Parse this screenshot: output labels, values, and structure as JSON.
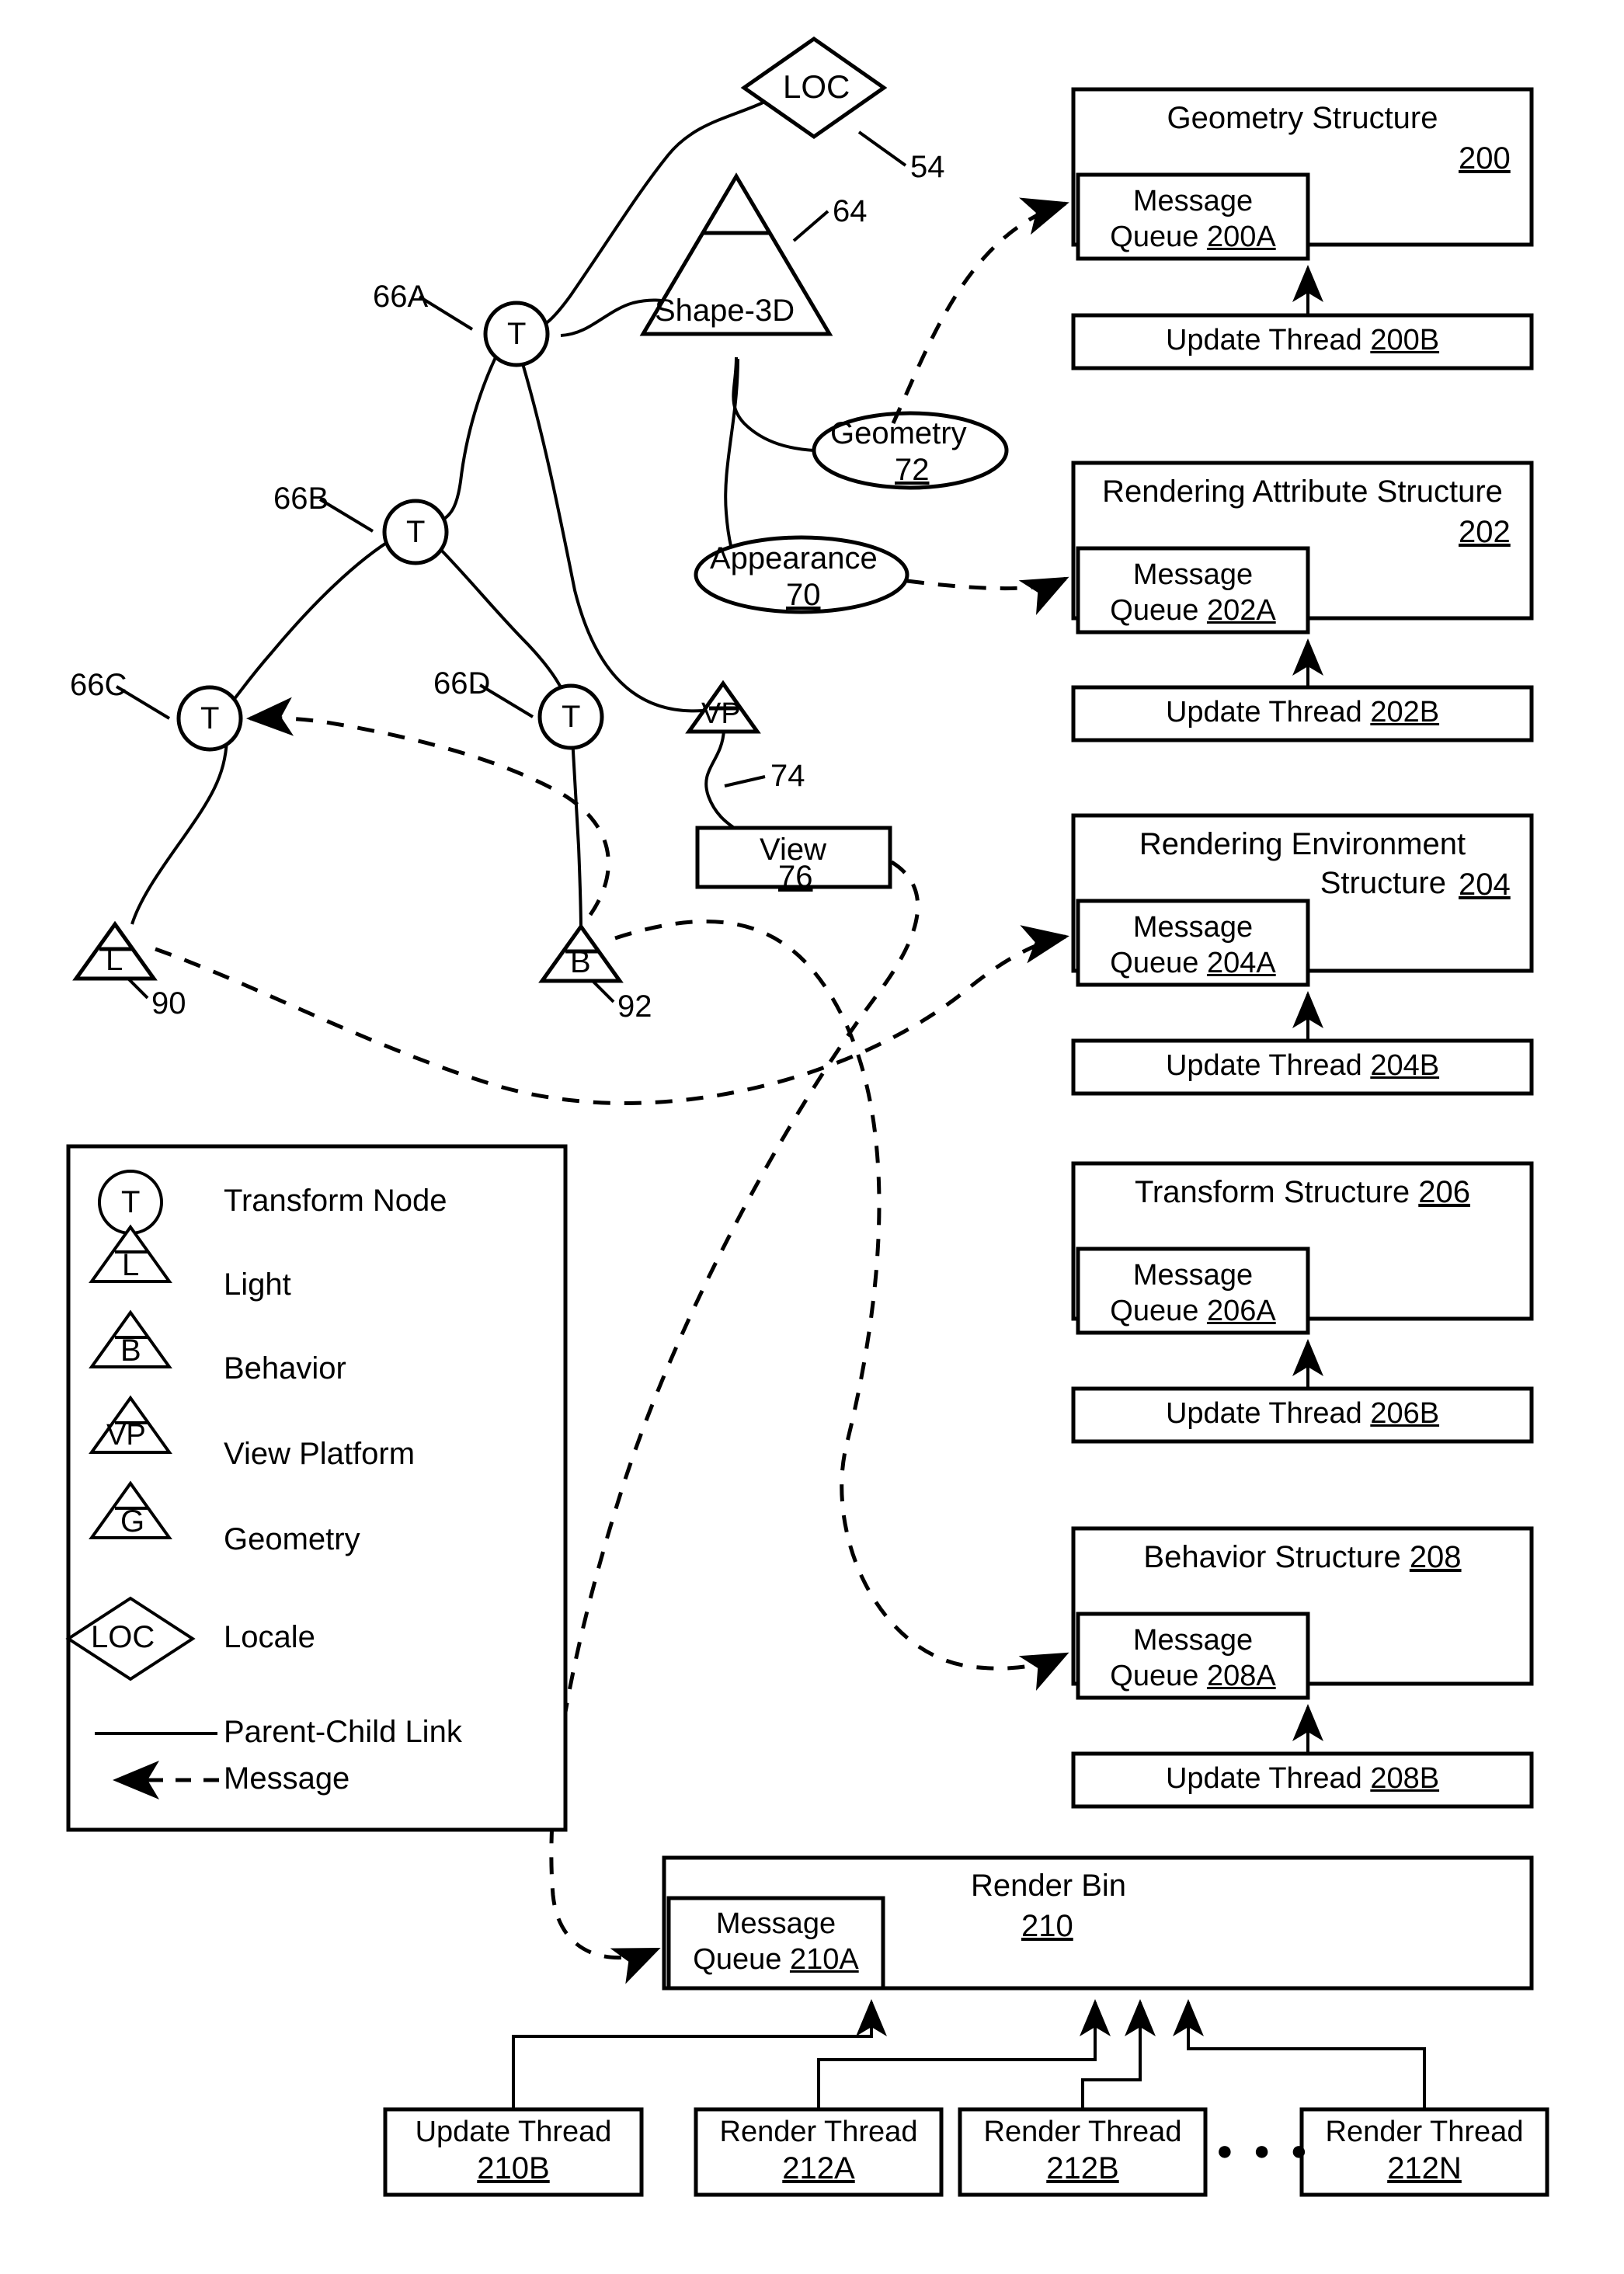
{
  "figure": {
    "type": "patent-diagram",
    "title": "Scene graph and retained mode structures with message queues and threads"
  },
  "scene_graph": {
    "locale": {
      "label": "LOC",
      "ref": "54"
    },
    "shape3d": {
      "label": "Shape-3D",
      "ref": "64"
    },
    "transforms": [
      {
        "label": "T",
        "ref": "66A"
      },
      {
        "label": "T",
        "ref": "66B"
      },
      {
        "label": "T",
        "ref": "66C"
      },
      {
        "label": "T",
        "ref": "66D"
      }
    ],
    "geometry_node": {
      "label": "Geometry",
      "ref": "72"
    },
    "appearance_node": {
      "label": "Appearance",
      "ref": "70"
    },
    "viewplatform": {
      "label": "VP",
      "ref": "74"
    },
    "view": {
      "label": "View",
      "ref": "76"
    },
    "light": {
      "label": "L",
      "ref": "90"
    },
    "behavior": {
      "label": "B",
      "ref": "92"
    }
  },
  "structures": [
    {
      "title": "Geometry Structure",
      "ref": "200",
      "queue_line1": "Message",
      "queue_line2": "Queue ",
      "queue_ref": "200A",
      "thread_label": "Update Thread ",
      "thread_ref": "200B"
    },
    {
      "title": "Rendering Attribute Structure",
      "ref": "202",
      "queue_line1": "Message",
      "queue_line2": "Queue ",
      "queue_ref": "202A",
      "thread_label": "Update Thread ",
      "thread_ref": "202B"
    },
    {
      "title": "Rendering Environment",
      "title2": "Structure",
      "ref": "204",
      "queue_line1": "Message",
      "queue_line2": "Queue ",
      "queue_ref": "204A",
      "thread_label": "Update Thread ",
      "thread_ref": "204B"
    },
    {
      "title": "Transform Structure ",
      "ref": "206",
      "queue_line1": "Message",
      "queue_line2": "Queue ",
      "queue_ref": "206A",
      "thread_label": "Update Thread ",
      "thread_ref": "206B"
    },
    {
      "title": "Behavior Structure ",
      "ref": "208",
      "queue_line1": "Message",
      "queue_line2": "Queue ",
      "queue_ref": "208A",
      "thread_label": "Update Thread ",
      "thread_ref": "208B"
    }
  ],
  "render_bin": {
    "title": "Render Bin",
    "ref": "210",
    "queue_line1": "Message",
    "queue_line2": "Queue ",
    "queue_ref": "210A",
    "threads": [
      {
        "label": "Update Thread",
        "ref": "210B"
      },
      {
        "label": "Render Thread",
        "ref": "212A"
      },
      {
        "label": "Render Thread",
        "ref": "212B"
      },
      {
        "label": "Render Thread",
        "ref": "212N"
      }
    ],
    "ellipsis": "● ● ●"
  },
  "legend": {
    "items": [
      {
        "glyph": "T",
        "shape": "circle",
        "label": "Transform Node"
      },
      {
        "glyph": "L",
        "shape": "triangle",
        "label": "Light"
      },
      {
        "glyph": "B",
        "shape": "triangle",
        "label": "Behavior"
      },
      {
        "glyph": "VP",
        "shape": "triangle",
        "label": "View Platform"
      },
      {
        "glyph": "G",
        "shape": "triangle",
        "label": "Geometry"
      },
      {
        "glyph": "LOC",
        "shape": "diamond",
        "label": "Locale"
      }
    ],
    "lines": [
      {
        "style": "solid",
        "label": "Parent-Child Link"
      },
      {
        "style": "dashed-arrow",
        "label": "Message"
      }
    ]
  }
}
